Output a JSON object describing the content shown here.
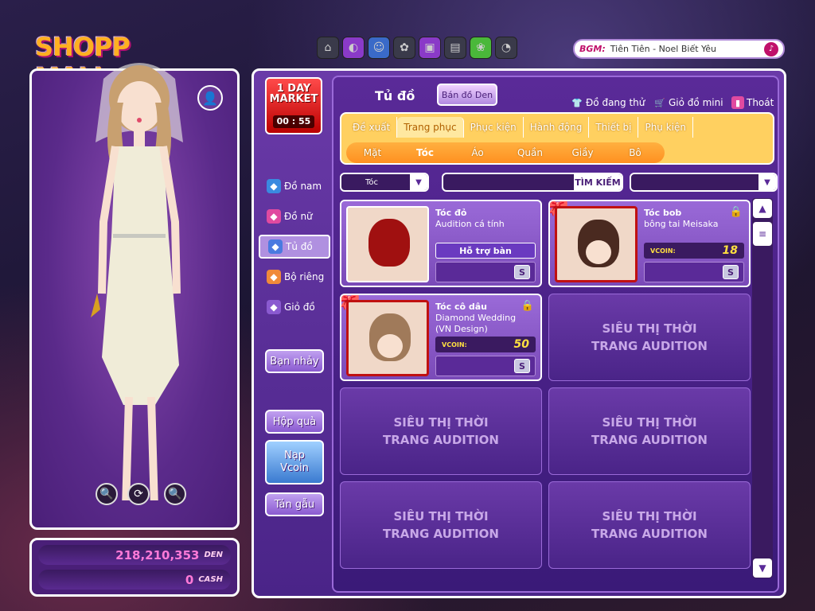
{
  "logo": {
    "left": "SHOPP",
    "right": "MALL"
  },
  "bgm": {
    "label": "BGM:",
    "title": "Tiên Tiên - Noel Biết Yêu"
  },
  "topbar": {
    "icons": [
      "house-icon",
      "egg-icon",
      "face-icon",
      "gear-icon",
      "tv-icon",
      "photo-icon",
      "khuvuon-icon",
      "settings-icon"
    ]
  },
  "money": {
    "den": "218,210,353",
    "den_label": "DEN",
    "cash": "0",
    "cash_label": "CASH"
  },
  "oneday": {
    "line1": "1 DAY",
    "line2": "MARKET",
    "timer": "00 : 55"
  },
  "leftnav": [
    {
      "label": "Đồ nam",
      "color": "#3a8ae0"
    },
    {
      "label": "Đồ nữ",
      "color": "#e04aa0"
    },
    {
      "label": "Tủ đồ",
      "color": "#4a7ae0"
    },
    {
      "label": "Bộ riêng",
      "color": "#f08a3a"
    },
    {
      "label": "Giỏ đồ",
      "color": "#8a5ad0"
    }
  ],
  "sidebuttons": {
    "dance": "Bạn nhảy",
    "gift": "Hộp quà",
    "topup1": "Nạp",
    "topup2": "Vcoin",
    "chat": "Tán gẫu"
  },
  "header": {
    "title": "Tủ đồ",
    "sell": "Bán đồ Den",
    "trying": "Đồ đang thử",
    "mini_cart": "Giỏ đồ mini",
    "exit": "Thoát"
  },
  "tabs_top": [
    "Đề xuất",
    "Trang phục",
    "Phục kiện",
    "Hành động",
    "Thiết bị",
    "Phụ kiện"
  ],
  "tabs_top_active": "Trang phục",
  "tabs_sub": [
    "Mặt",
    "Tóc",
    "Áo",
    "Quần",
    "Giầy",
    "Bô"
  ],
  "tabs_sub_active": "Tóc",
  "filter": {
    "category": "Tóc",
    "search_btn": "TÌM KIẾM"
  },
  "items": [
    {
      "name1": "Tóc đỏ",
      "name2": "Audition cá tính",
      "action": "Hỗ trợ bàn",
      "hair": "#a01010"
    },
    {
      "name1": "Tóc bob",
      "name2": "bông tai Meisaka",
      "currency": "VCOIN:",
      "price": "18",
      "hair": "#4a2a20"
    },
    {
      "name1": "Tóc cô dâu",
      "name2": "Diamond Wedding",
      "name3": "(VN Design)",
      "currency": "VCOIN:",
      "price": "50",
      "hair": "#a07a5a"
    }
  ],
  "empty_label1": "SIÊU THỊ THỜI",
  "empty_label2": "TRANG AUDITION",
  "buy_symbol": "S"
}
